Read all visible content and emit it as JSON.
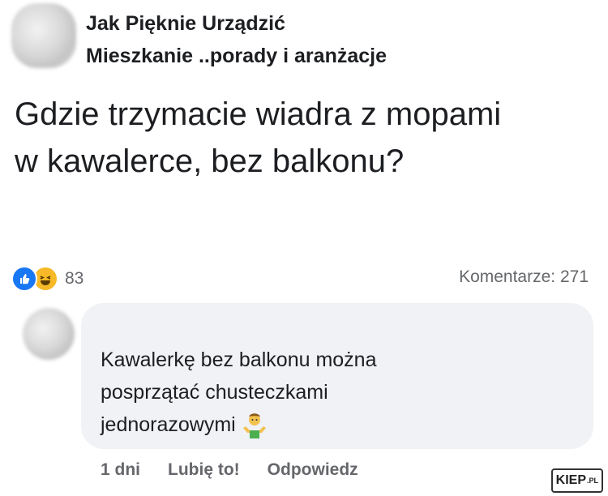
{
  "group": {
    "name": "Jak Pięknie Urządzić",
    "subtitle": "Mieszkanie ..porady i aranżacje"
  },
  "post": {
    "text": "Gdzie trzymacie wiadra z mopami w kawalerce, bez balkonu?"
  },
  "reactions": {
    "icons": [
      "like-icon",
      "haha-icon"
    ],
    "count": "83"
  },
  "comments_summary": "Komentarze: 271",
  "comment": {
    "text": "Kawalerkę bez balkonu można posprzątać chusteczkami jednorazowymi",
    "emoji": "shrug-emoji",
    "actions": {
      "time": "1 dni",
      "like": "Lubię to!",
      "reply": "Odpowiedz"
    }
  },
  "watermark": {
    "text": "KIEP",
    "suffix": ".PL"
  },
  "colors": {
    "like_blue": "#1877f2",
    "haha_yellow": "#f7b928",
    "bubble_bg": "#f0f2f5",
    "muted_text": "#65676b"
  }
}
